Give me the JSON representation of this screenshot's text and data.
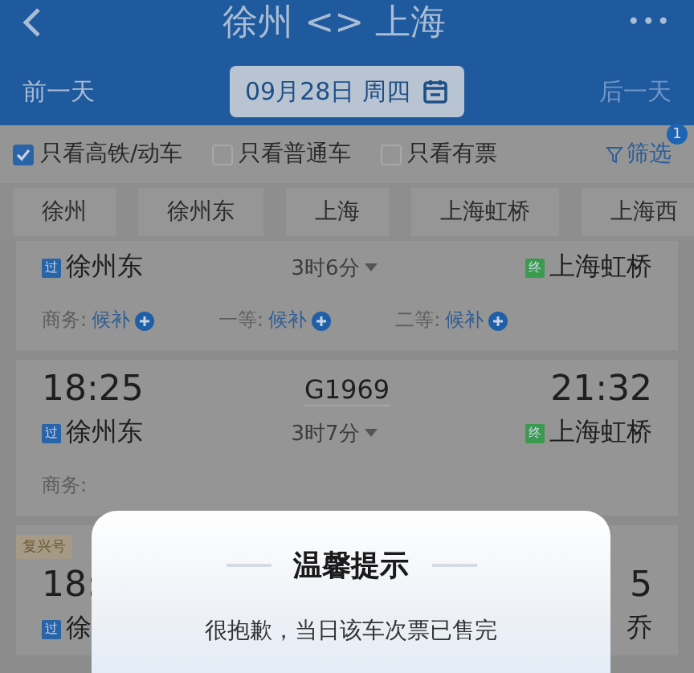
{
  "header": {
    "title": "徐州 <> 上海",
    "more": "•••"
  },
  "date_bar": {
    "prev": "前一天",
    "date": "09月28日 周四",
    "next": "后一天",
    "next_disabled": true
  },
  "filters": [
    {
      "label": "只看高铁/动车",
      "checked": true
    },
    {
      "label": "只看普通车",
      "checked": false
    },
    {
      "label": "只看有票",
      "checked": false
    }
  ],
  "filter_button": {
    "label": "筛选",
    "badge": "1"
  },
  "stations": [
    {
      "label": "徐州"
    },
    {
      "label": "徐州东"
    },
    {
      "label": "上海"
    },
    {
      "label": "上海虹桥"
    },
    {
      "label": "上海西"
    }
  ],
  "trains": [
    {
      "from_mark": "过",
      "from_station": "徐州东",
      "duration": "3时6分",
      "to_mark": "终",
      "to_station": "上海虹桥",
      "seats": [
        {
          "class": "商务:",
          "status": "候补"
        },
        {
          "class": "一等:",
          "status": "候补"
        },
        {
          "class": "二等:",
          "status": "候补"
        }
      ]
    },
    {
      "depart": "18:25",
      "number": "G1969",
      "arrive": "21:32",
      "from_mark": "过",
      "from_station": "徐州东",
      "duration": "3时7分",
      "to_mark": "终",
      "to_station": "上海虹桥",
      "seats": [
        {
          "class": "商务:"
        }
      ]
    },
    {
      "tag": "复兴号",
      "depart": "18:",
      "arrive": "5",
      "from_mark": "过",
      "from_station": "徐",
      "to_station": "乔"
    }
  ],
  "dialog": {
    "title": "温馨提示",
    "message": "很抱歉，当日该车次票已售完"
  }
}
